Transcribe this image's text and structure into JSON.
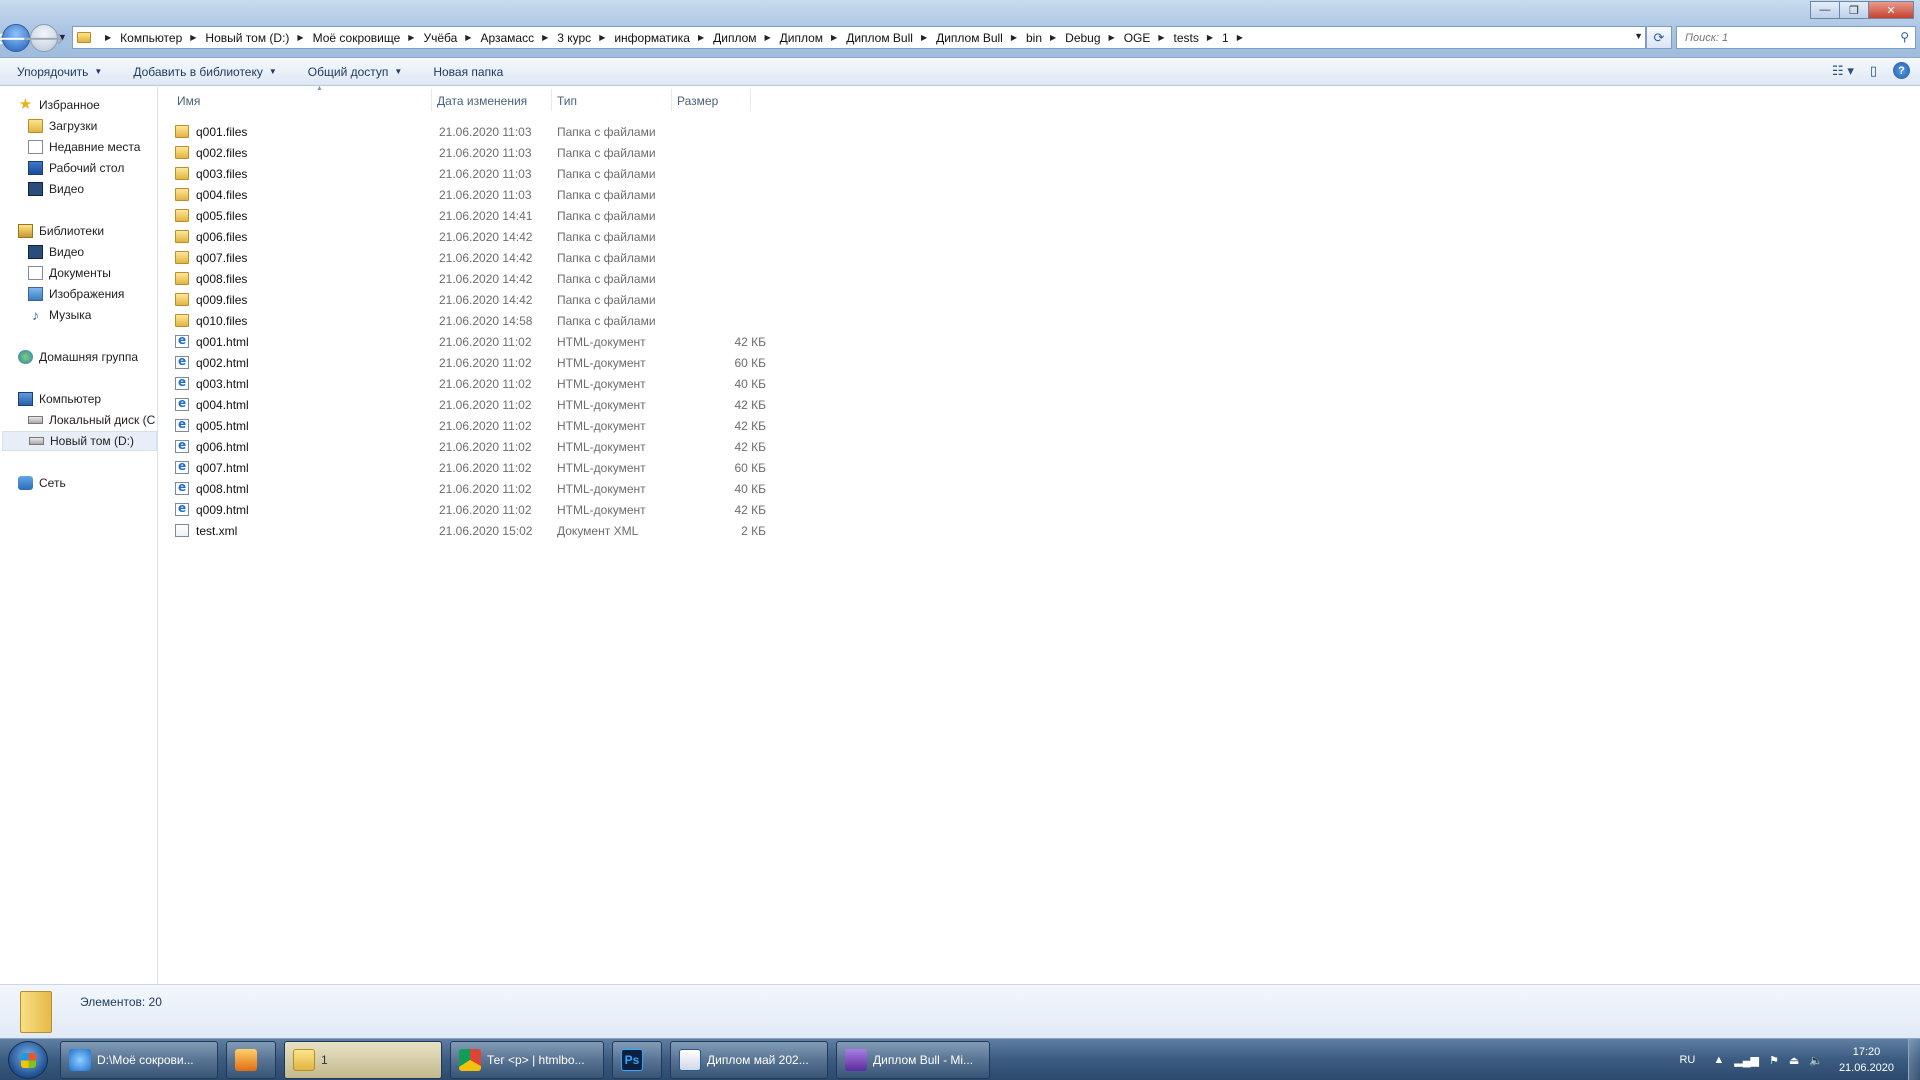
{
  "window": {
    "title_controls": {
      "minimize": "—",
      "maximize": "❐",
      "close": "✕"
    }
  },
  "address": {
    "crumbs": [
      "Компьютер",
      "Новый том (D:)",
      "Моё сокровище",
      "Учёба",
      "Арзамасс",
      "3 курс",
      "информатика",
      "Диплом",
      "Диплом",
      "Диплом Bull",
      "Диплом Bull",
      "bin",
      "Debug",
      "OGE",
      "tests",
      "1"
    ],
    "search_placeholder": "Поиск: 1"
  },
  "toolbar": {
    "organize": "Упорядочить",
    "add_to_library": "Добавить в библиотеку",
    "share": "Общий доступ",
    "new_folder": "Новая папка"
  },
  "sidebar": {
    "favorites": "Избранное",
    "downloads": "Загрузки",
    "recent": "Недавние места",
    "desktop": "Рабочий стол",
    "video_fav": "Видео",
    "libraries": "Библиотеки",
    "video": "Видео",
    "documents": "Документы",
    "images": "Изображения",
    "music": "Музыка",
    "homegroup": "Домашняя группа",
    "computer": "Компьютер",
    "local_disk": "Локальный диск (C",
    "new_volume": "Новый том (D:)",
    "network": "Сеть"
  },
  "columns": {
    "name": "Имя",
    "date": "Дата изменения",
    "type": "Тип",
    "size": "Размер"
  },
  "files": [
    {
      "name": "q001.files",
      "date": "21.06.2020 11:03",
      "type": "Папка с файлами",
      "size": "",
      "kind": "folder"
    },
    {
      "name": "q002.files",
      "date": "21.06.2020 11:03",
      "type": "Папка с файлами",
      "size": "",
      "kind": "folder"
    },
    {
      "name": "q003.files",
      "date": "21.06.2020 11:03",
      "type": "Папка с файлами",
      "size": "",
      "kind": "folder"
    },
    {
      "name": "q004.files",
      "date": "21.06.2020 11:03",
      "type": "Папка с файлами",
      "size": "",
      "kind": "folder"
    },
    {
      "name": "q005.files",
      "date": "21.06.2020 14:41",
      "type": "Папка с файлами",
      "size": "",
      "kind": "folder"
    },
    {
      "name": "q006.files",
      "date": "21.06.2020 14:42",
      "type": "Папка с файлами",
      "size": "",
      "kind": "folder"
    },
    {
      "name": "q007.files",
      "date": "21.06.2020 14:42",
      "type": "Папка с файлами",
      "size": "",
      "kind": "folder"
    },
    {
      "name": "q008.files",
      "date": "21.06.2020 14:42",
      "type": "Папка с файлами",
      "size": "",
      "kind": "folder"
    },
    {
      "name": "q009.files",
      "date": "21.06.2020 14:42",
      "type": "Папка с файлами",
      "size": "",
      "kind": "folder"
    },
    {
      "name": "q010.files",
      "date": "21.06.2020 14:58",
      "type": "Папка с файлами",
      "size": "",
      "kind": "folder"
    },
    {
      "name": "q001.html",
      "date": "21.06.2020 11:02",
      "type": "HTML-документ",
      "size": "42 КБ",
      "kind": "html"
    },
    {
      "name": "q002.html",
      "date": "21.06.2020 11:02",
      "type": "HTML-документ",
      "size": "60 КБ",
      "kind": "html"
    },
    {
      "name": "q003.html",
      "date": "21.06.2020 11:02",
      "type": "HTML-документ",
      "size": "40 КБ",
      "kind": "html"
    },
    {
      "name": "q004.html",
      "date": "21.06.2020 11:02",
      "type": "HTML-документ",
      "size": "42 КБ",
      "kind": "html"
    },
    {
      "name": "q005.html",
      "date": "21.06.2020 11:02",
      "type": "HTML-документ",
      "size": "42 КБ",
      "kind": "html"
    },
    {
      "name": "q006.html",
      "date": "21.06.2020 11:02",
      "type": "HTML-документ",
      "size": "42 КБ",
      "kind": "html"
    },
    {
      "name": "q007.html",
      "date": "21.06.2020 11:02",
      "type": "HTML-документ",
      "size": "60 КБ",
      "kind": "html"
    },
    {
      "name": "q008.html",
      "date": "21.06.2020 11:02",
      "type": "HTML-документ",
      "size": "40 КБ",
      "kind": "html"
    },
    {
      "name": "q009.html",
      "date": "21.06.2020 11:02",
      "type": "HTML-документ",
      "size": "42 КБ",
      "kind": "html"
    },
    {
      "name": "test.xml",
      "date": "21.06.2020 15:02",
      "type": "Документ XML",
      "size": "2 КБ",
      "kind": "xml"
    }
  ],
  "details": {
    "count": "Элементов: 20"
  },
  "taskbar": {
    "items": [
      {
        "label": "D:\\Моё сокрови...",
        "icon": "ie-icon"
      },
      {
        "label": "",
        "icon": "media-player-icon"
      },
      {
        "label": "1",
        "icon": "folder-icon"
      },
      {
        "label": "Тег <p> | htmlbo...",
        "icon": "chrome-icon"
      },
      {
        "label": "",
        "icon": "photoshop-icon"
      },
      {
        "label": "Диплом май 202...",
        "icon": "word-icon"
      },
      {
        "label": "Диплом Bull - Mi...",
        "icon": "visual-studio-icon"
      }
    ],
    "ps_glyph": "Ps",
    "lang": "RU",
    "time": "17:20",
    "date": "21.06.2020"
  }
}
